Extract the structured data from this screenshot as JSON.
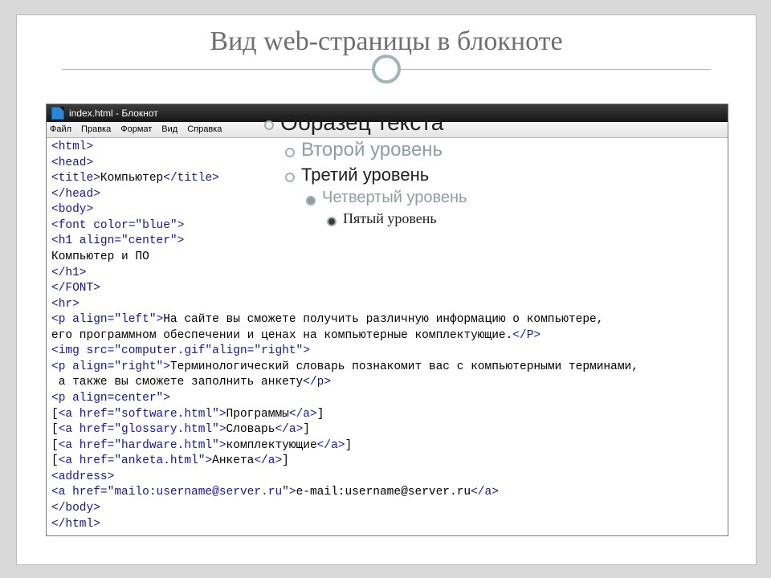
{
  "slide": {
    "title": "Вид web-страницы в блокноте"
  },
  "overlay": {
    "lv1": "Образец текста",
    "lv2": "Второй уровень",
    "lv3": "Третий уровень",
    "lv4": "Четвертый уровень",
    "lv5": "Пятый уровень"
  },
  "notepad": {
    "title": "index.html - Блокнот",
    "menu": [
      "Файл",
      "Правка",
      "Формат",
      "Вид",
      "Справка"
    ],
    "lines": [
      {
        "tag": "<html>"
      },
      {
        "tag": "<head>"
      },
      {
        "tag": "<title>",
        "text": "Компьютер",
        "close": "</title>"
      },
      {
        "tag": "</head>"
      },
      {
        "tag": "<body>"
      },
      {
        "tag": "<font color=\"blue\">"
      },
      {
        "tag": "<h1 align=\"center\">"
      },
      {
        "text": "Компьютер и ПО"
      },
      {
        "tag": "</h1>"
      },
      {
        "tag": "</FONT>"
      },
      {
        "tag": "<hr>"
      },
      {
        "tag": "<p align=\"left\">",
        "text": "На сайте вы сможете получить различную информацию о компьютере,"
      },
      {
        "text": "его программном обеспечении и ценах на компьютерные комплектующие.",
        "close": "</P>"
      },
      {
        "tag": "<img src=\"computer.gif\"align=\"right\">"
      },
      {
        "tag": "<p align=\"right\">",
        "text": "Терминологический словарь познакомит вас с компьютерными терминами,"
      },
      {
        "text": " а также вы сможете заполнить анкету",
        "close": "</p>"
      },
      {
        "tag": "<p align=center\">"
      },
      {
        "text": "[",
        "tag2": "<a href=\"software.html\">",
        "mid": "Программы",
        "close": "</a>",
        "after": "]"
      },
      {
        "text": "[",
        "tag2": "<a href=\"glossary.html\">",
        "mid": "Словарь",
        "close": "</a>",
        "after": "]"
      },
      {
        "text": "[",
        "tag2": "<a href=\"hardware.html\">",
        "mid": "комплектующие",
        "close": "</a>",
        "after": "]"
      },
      {
        "text": "[",
        "tag2": "<a href=\"anketa.html\">",
        "mid": "Анкета",
        "close": "</a>",
        "after": "]"
      },
      {
        "tag": "<address>"
      },
      {
        "tag": "<a href=\"mailo:username@server.ru\">",
        "text": "e-mail:username@server.ru",
        "close": "</a>"
      },
      {
        "tag": "</body>"
      },
      {
        "tag": "</html>"
      }
    ]
  }
}
